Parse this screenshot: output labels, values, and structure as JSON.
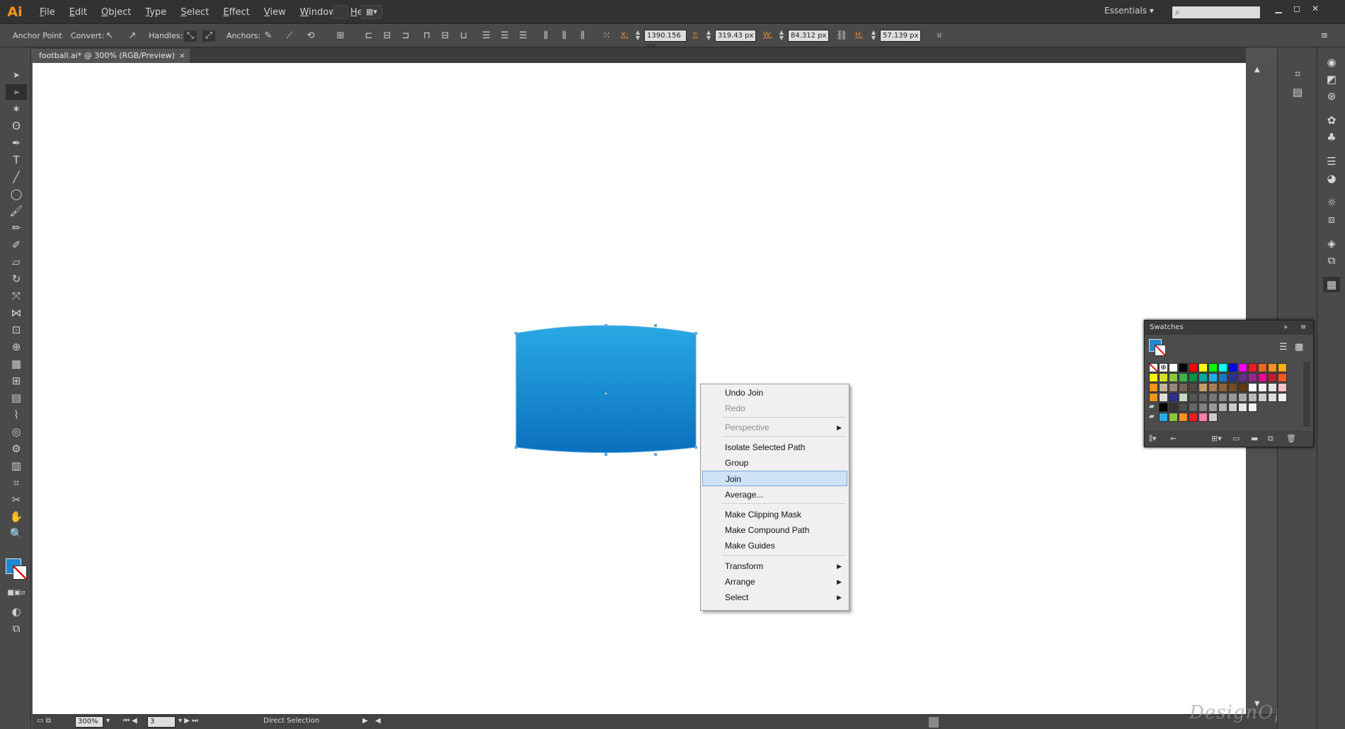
{
  "app": {
    "logo": "Ai",
    "menus": [
      "File",
      "Edit",
      "Object",
      "Type",
      "Select",
      "Effect",
      "View",
      "Window",
      "Help"
    ],
    "workspace": "Essentials"
  },
  "control": {
    "anchor_point": "Anchor Point",
    "convert": "Convert:",
    "handles": "Handles:",
    "anchors": "Anchors:",
    "x_label": "X:",
    "x_value": "1390.156 px",
    "y_label": "Y:",
    "y_value": "319.43 px",
    "w_label": "W:",
    "w_value": "84.312 px",
    "h_label": "H:",
    "h_value": "57.139 px"
  },
  "document": {
    "tab_title": "football.ai* @ 300% (RGB/Preview)",
    "close": "×"
  },
  "status": {
    "zoom": "300%",
    "artboard": "3",
    "tool": "Direct Selection"
  },
  "watermark": "DesignOptimal.com",
  "shape": {
    "gradient_top": "#29a9e4",
    "gradient_bottom": "#0a70be"
  },
  "swatches": {
    "title": "Swatches",
    "colors": [
      [
        "none",
        "reg",
        "#ffffff",
        "#000000",
        "#ff0000",
        "#ffff00",
        "#00ff00",
        "#00ffff",
        "#0000ff",
        "#ff00ff",
        "#ed1c24",
        "#f26522",
        "#f7941d",
        "#fbae17"
      ],
      [
        "#fff200",
        "#d7df23",
        "#8dc63f",
        "#39b54a",
        "#009444",
        "#00a99d",
        "#27aae1",
        "#1c75bc",
        "#2e3192",
        "#662d91",
        "#92278f",
        "#ec008c",
        "#be1e2d",
        "#f15a24"
      ],
      [
        "#f7941d",
        "#c2b59b",
        "#998675",
        "#736357",
        "#534741",
        "#c69c6d",
        "#a67c52",
        "#8c6239",
        "#754c24",
        "#603813",
        "#ffffff",
        "#f5f5f5",
        "#e6e6e6",
        "#ffc0cb"
      ],
      [
        "#f7941d",
        "#dddddd",
        "#2e3192",
        "#c6d8c6",
        "#555555",
        "#666666",
        "#777777",
        "#888888",
        "#999999",
        "#aaaaaa",
        "#bbbbbb",
        "#cccccc",
        "#dddddd",
        "#eeeeee"
      ],
      [
        "folder",
        "#000000",
        "#333333",
        "#4d4d4d",
        "#666666",
        "#808080",
        "#999999",
        "#b3b3b3",
        "#cccccc",
        "#e6e6e6",
        "#f2f2f2"
      ],
      [
        "folder",
        "#29abe2",
        "#8cc63f",
        "#f7931e",
        "#ed1c24",
        "#ff7bac",
        "#cccccc"
      ]
    ]
  },
  "context_menu": {
    "items": [
      {
        "label": "Undo Join",
        "disabled": false,
        "submenu": false
      },
      {
        "label": "Redo",
        "disabled": true,
        "submenu": false
      },
      {
        "label": "Perspective",
        "disabled": true,
        "submenu": true
      },
      {
        "label": "Isolate Selected Path",
        "disabled": false,
        "submenu": false
      },
      {
        "label": "Group",
        "disabled": false,
        "submenu": false
      },
      {
        "label": "Join",
        "disabled": false,
        "submenu": false,
        "highlighted": true
      },
      {
        "label": "Average...",
        "disabled": false,
        "submenu": false
      },
      {
        "label": "Make Clipping Mask",
        "disabled": false,
        "submenu": false
      },
      {
        "label": "Make Compound Path",
        "disabled": false,
        "submenu": false
      },
      {
        "label": "Make Guides",
        "disabled": false,
        "submenu": false
      },
      {
        "label": "Transform",
        "disabled": false,
        "submenu": true
      },
      {
        "label": "Arrange",
        "disabled": false,
        "submenu": true
      },
      {
        "label": "Select",
        "disabled": false,
        "submenu": true
      }
    ]
  }
}
